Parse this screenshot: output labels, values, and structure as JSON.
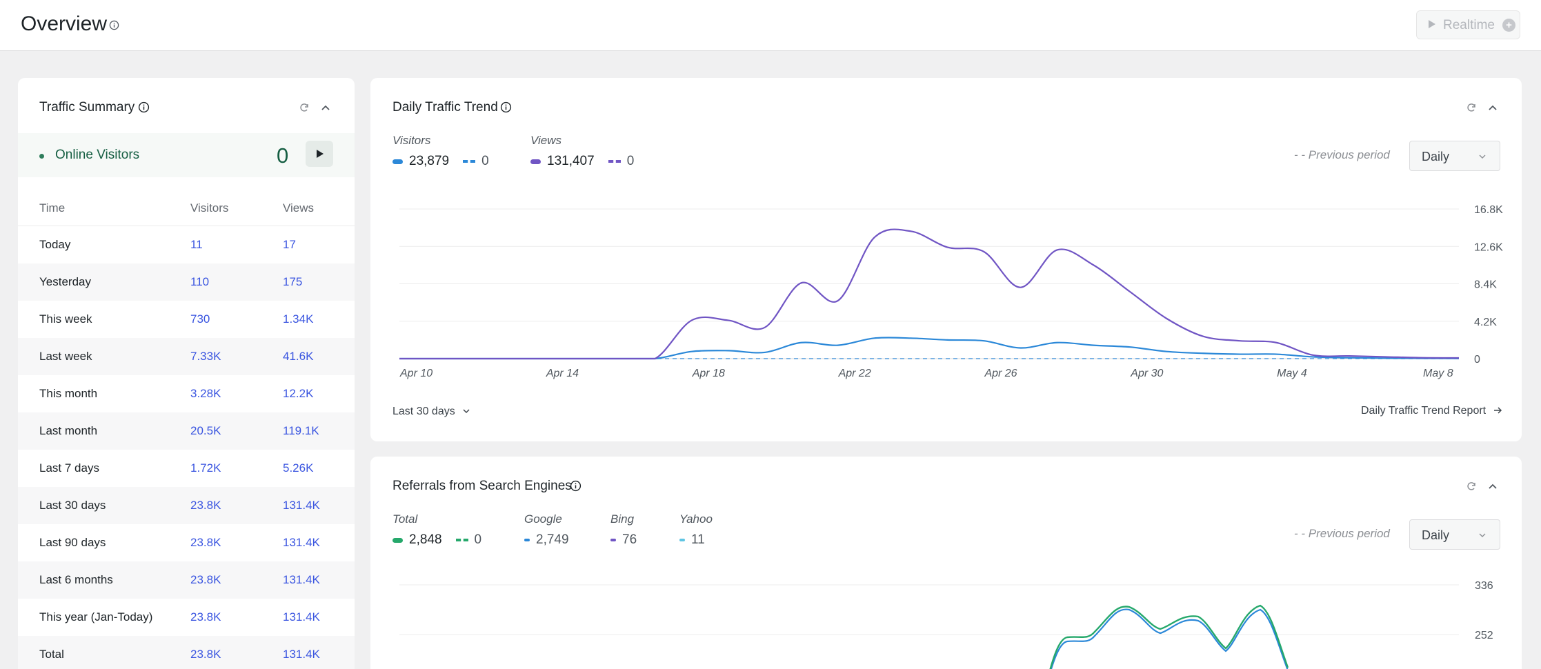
{
  "page": {
    "title": "Overview"
  },
  "realtime": {
    "label": "Realtime"
  },
  "traffic_summary": {
    "title": "Traffic Summary",
    "online_label": "Online Visitors",
    "online_count": "0",
    "columns": [
      "Time",
      "Visitors",
      "Views"
    ],
    "rows": [
      {
        "time": "Today",
        "visitors": "11",
        "views": "17"
      },
      {
        "time": "Yesterday",
        "visitors": "110",
        "views": "175"
      },
      {
        "time": "This week",
        "visitors": "730",
        "views": "1.34K"
      },
      {
        "time": "Last week",
        "visitors": "7.33K",
        "views": "41.6K"
      },
      {
        "time": "This month",
        "visitors": "3.28K",
        "views": "12.2K"
      },
      {
        "time": "Last month",
        "visitors": "20.5K",
        "views": "119.1K"
      },
      {
        "time": "Last 7 days",
        "visitors": "1.72K",
        "views": "5.26K"
      },
      {
        "time": "Last 30 days",
        "visitors": "23.8K",
        "views": "131.4K"
      },
      {
        "time": "Last 90 days",
        "visitors": "23.8K",
        "views": "131.4K"
      },
      {
        "time": "Last 6 months",
        "visitors": "23.8K",
        "views": "131.4K"
      },
      {
        "time": "This year (Jan-Today)",
        "visitors": "23.8K",
        "views": "131.4K"
      },
      {
        "time": "Total",
        "visitors": "23.8K",
        "views": "131.4K"
      }
    ]
  },
  "daily_trend": {
    "title": "Daily Traffic Trend",
    "visitors_label": "Visitors",
    "visitors_total": "23,879",
    "visitors_prev": "0",
    "views_label": "Views",
    "views_total": "131,407",
    "views_prev": "0",
    "previous_period": "- -  Previous period",
    "granularity": "Daily",
    "range_label": "Last 30 days",
    "report_link": "Daily Traffic Trend Report"
  },
  "referrals": {
    "title": "Referrals from Search Engines",
    "total_label": "Total",
    "total_value": "2,848",
    "total_prev": "0",
    "google_label": "Google",
    "google_value": "2,749",
    "bing_label": "Bing",
    "bing_value": "76",
    "yahoo_label": "Yahoo",
    "yahoo_value": "11",
    "previous_period": "- -  Previous period",
    "granularity": "Daily"
  },
  "colors": {
    "visitors": "#2b88d8",
    "views": "#7055c4",
    "total": "#25a86b",
    "google": "#2b88d8",
    "bing": "#7055c4",
    "yahoo": "#5fc5e3",
    "link": "#3a55e0"
  },
  "chart_data": [
    {
      "type": "line",
      "title": "Daily Traffic Trend",
      "x": [
        "Apr 10",
        "Apr 11",
        "Apr 12",
        "Apr 13",
        "Apr 14",
        "Apr 15",
        "Apr 16",
        "Apr 17",
        "Apr 18",
        "Apr 19",
        "Apr 20",
        "Apr 21",
        "Apr 22",
        "Apr 23",
        "Apr 24",
        "Apr 25",
        "Apr 26",
        "Apr 27",
        "Apr 28",
        "Apr 29",
        "Apr 30",
        "May 1",
        "May 2",
        "May 3",
        "May 4",
        "May 5",
        "May 6",
        "May 7",
        "May 8",
        "May 9"
      ],
      "xtick_labels": [
        "Apr 10",
        "Apr 14",
        "Apr 18",
        "Apr 22",
        "Apr 26",
        "Apr 30",
        "May 4",
        "May 8"
      ],
      "ytick_labels": [
        "0",
        "4.2K",
        "8.4K",
        "12.6K",
        "16.8K"
      ],
      "ylim": [
        0,
        16800
      ],
      "series": [
        {
          "name": "Visitors",
          "values": [
            0,
            0,
            0,
            0,
            0,
            0,
            0,
            0,
            800,
            900,
            700,
            1800,
            1500,
            2300,
            2300,
            2100,
            2000,
            1200,
            1800,
            1500,
            1300,
            800,
            600,
            500,
            500,
            200,
            100,
            50,
            30,
            20
          ]
        },
        {
          "name": "Views",
          "values": [
            0,
            0,
            0,
            0,
            0,
            0,
            0,
            0,
            4300,
            4300,
            3500,
            8500,
            6500,
            13600,
            14300,
            12500,
            12000,
            8000,
            12200,
            10500,
            7500,
            4500,
            2500,
            2000,
            1800,
            400,
            300,
            200,
            100,
            80
          ]
        }
      ],
      "grid": true
    },
    {
      "type": "line",
      "title": "Referrals from Search Engines",
      "ytick_labels": [
        "336",
        "252"
      ],
      "series": [
        {
          "name": "Google"
        },
        {
          "name": "Total"
        }
      ],
      "grid": true
    }
  ]
}
